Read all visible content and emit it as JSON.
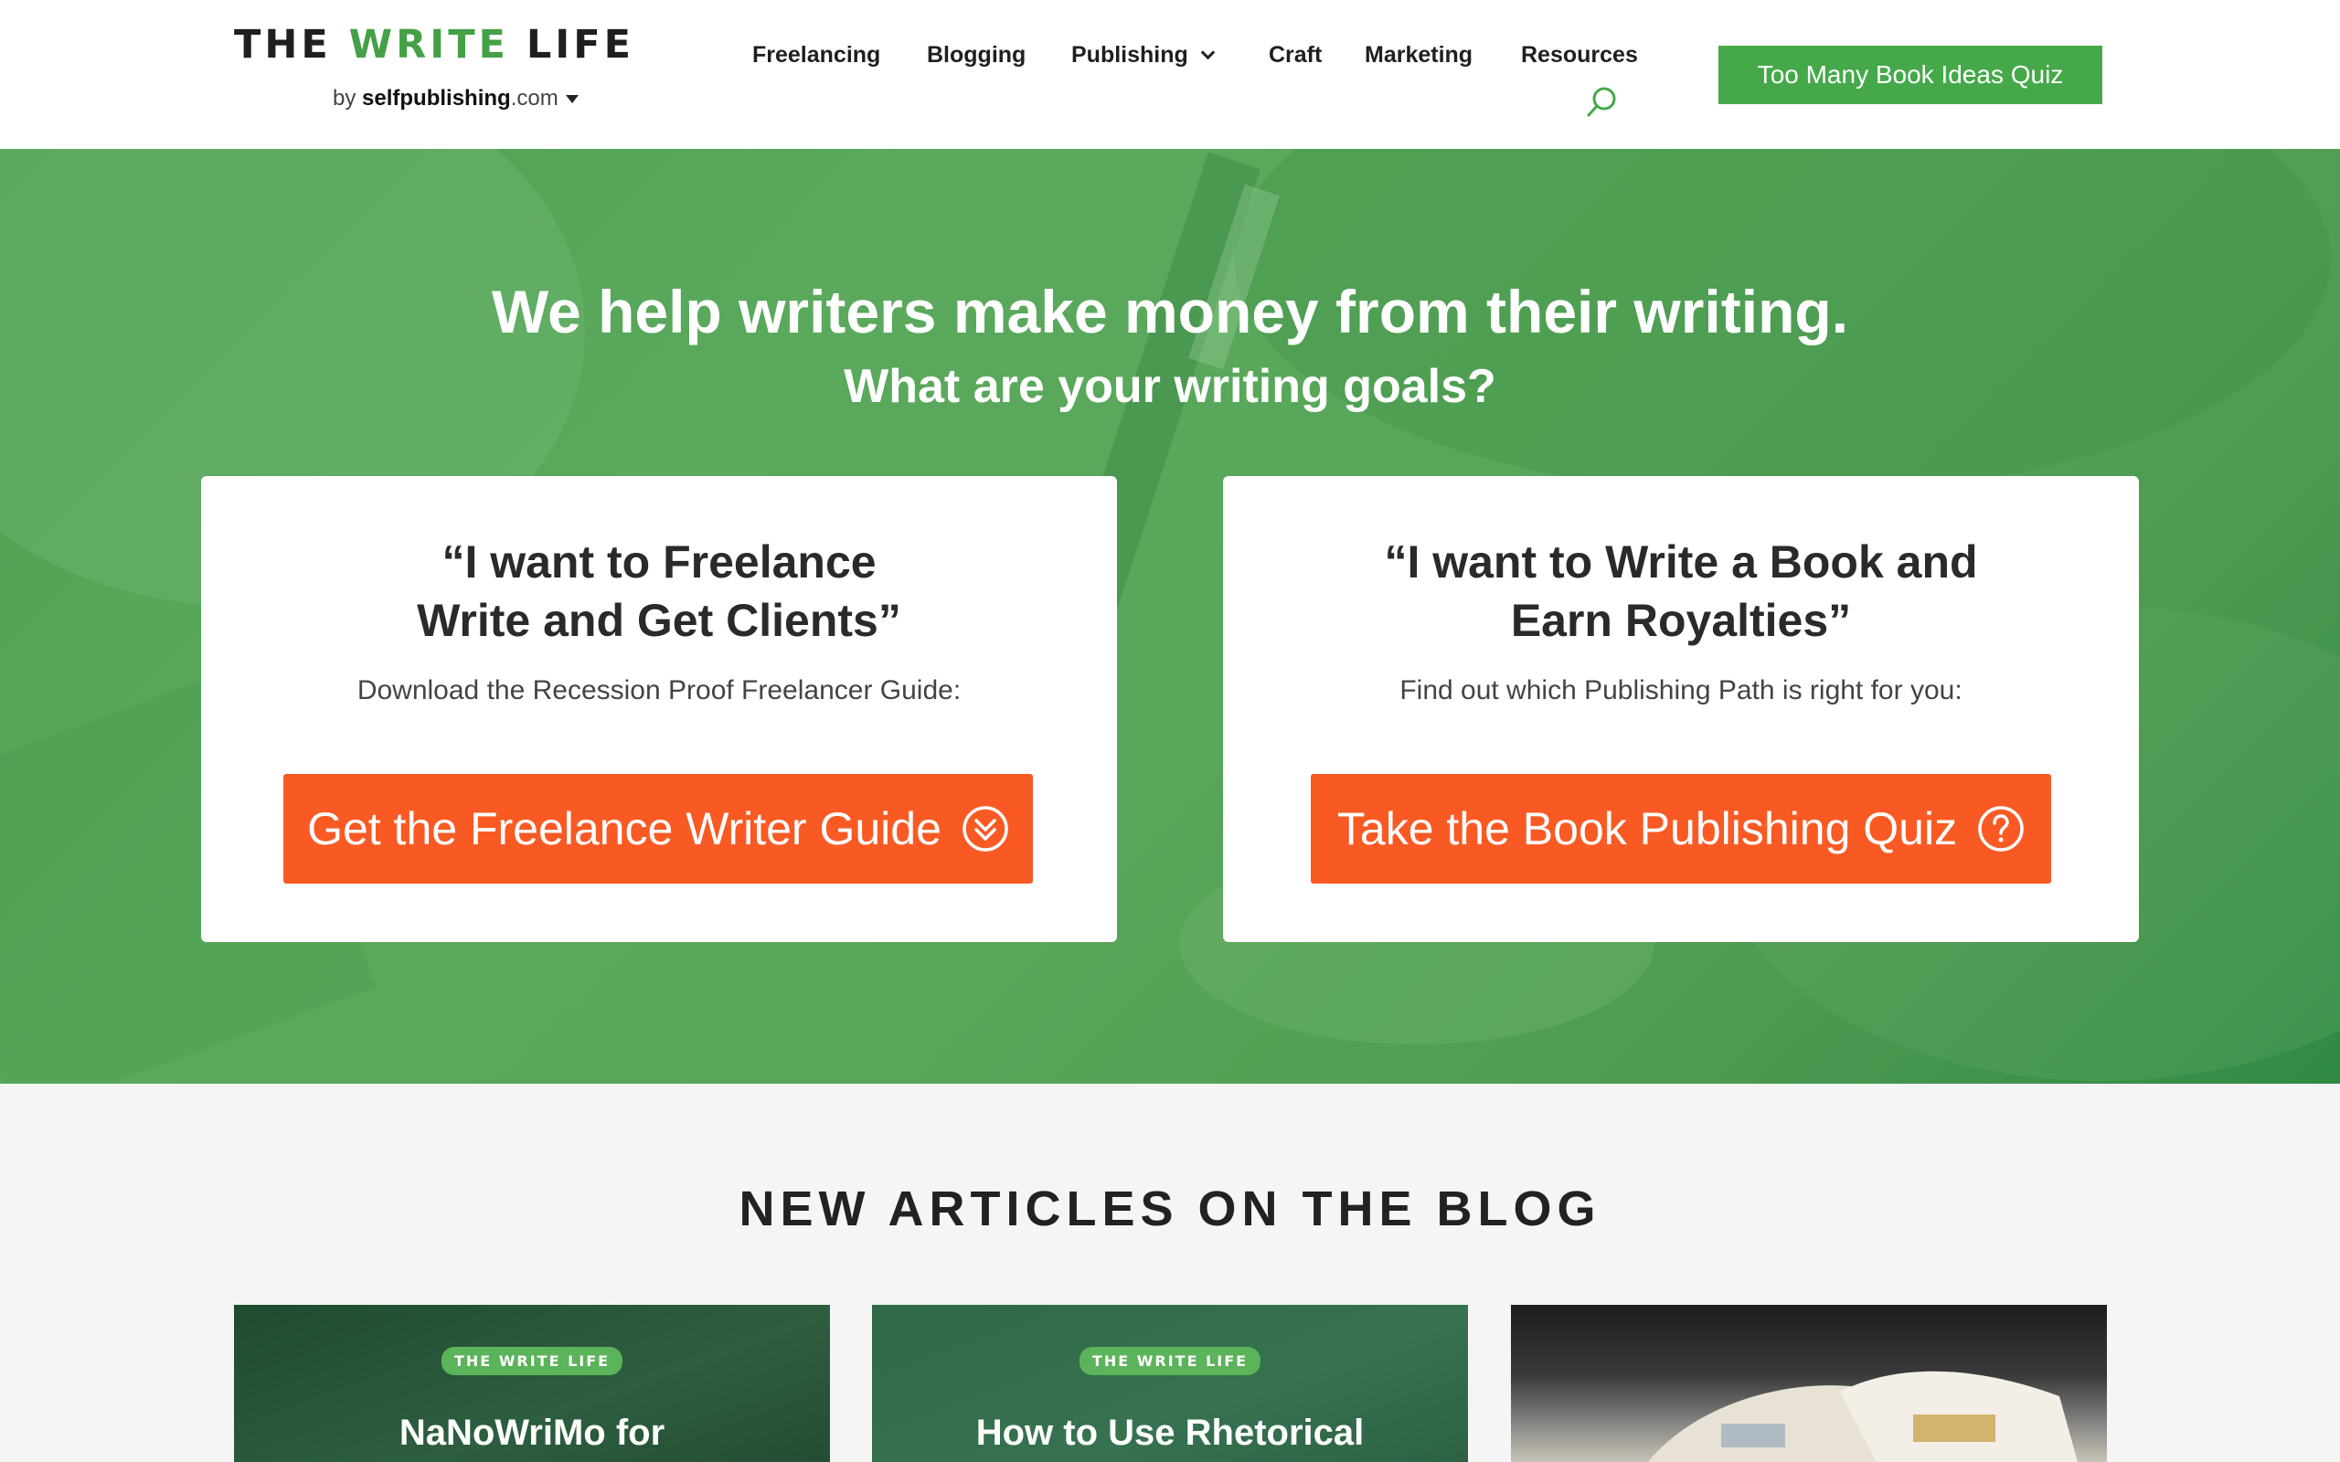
{
  "header": {
    "logo": {
      "part1": "THE ",
      "part2": "WRITE",
      "part3": " LIFE",
      "sub_prefix": "by ",
      "sub_bold": "selfpublishing",
      "sub_suffix": ".com"
    },
    "nav": [
      {
        "label": "Freelancing"
      },
      {
        "label": "Blogging"
      },
      {
        "label": "Publishing",
        "has_dropdown": true
      },
      {
        "label": "Craft"
      },
      {
        "label": "Marketing"
      },
      {
        "label": "Resources"
      }
    ],
    "search_icon": "search-icon",
    "quiz_button": "Too Many Book Ideas Quiz"
  },
  "hero": {
    "title": "We help writers make money from their writing.",
    "subtitle": "What are your writing goals?",
    "cards": [
      {
        "heading_line1": "“I want to Freelance",
        "heading_line2": "Write and Get Clients”",
        "text": "Download the Recession Proof Freelancer Guide:",
        "cta": "Get the Freelance Writer Guide",
        "cta_icon": "double-chevron-down-circle-icon"
      },
      {
        "heading_line1": "“I want to Write a Book and",
        "heading_line2": "Earn Royalties”",
        "text": "Find out which Publishing Path is right for you:",
        "cta": "Take the Book Publishing Quiz",
        "cta_icon": "question-circle-icon"
      }
    ]
  },
  "blog": {
    "heading": "NEW ARTICLES ON THE BLOG",
    "articles": [
      {
        "badge": "THE WRITE LIFE",
        "title": "NaNoWriMo for"
      },
      {
        "badge": "THE WRITE LIFE",
        "title": "How to Use Rhetorical"
      },
      {
        "badge": "",
        "title": ""
      }
    ]
  },
  "colors": {
    "brand_green": "#45a949",
    "cta_orange": "#f95a24"
  }
}
